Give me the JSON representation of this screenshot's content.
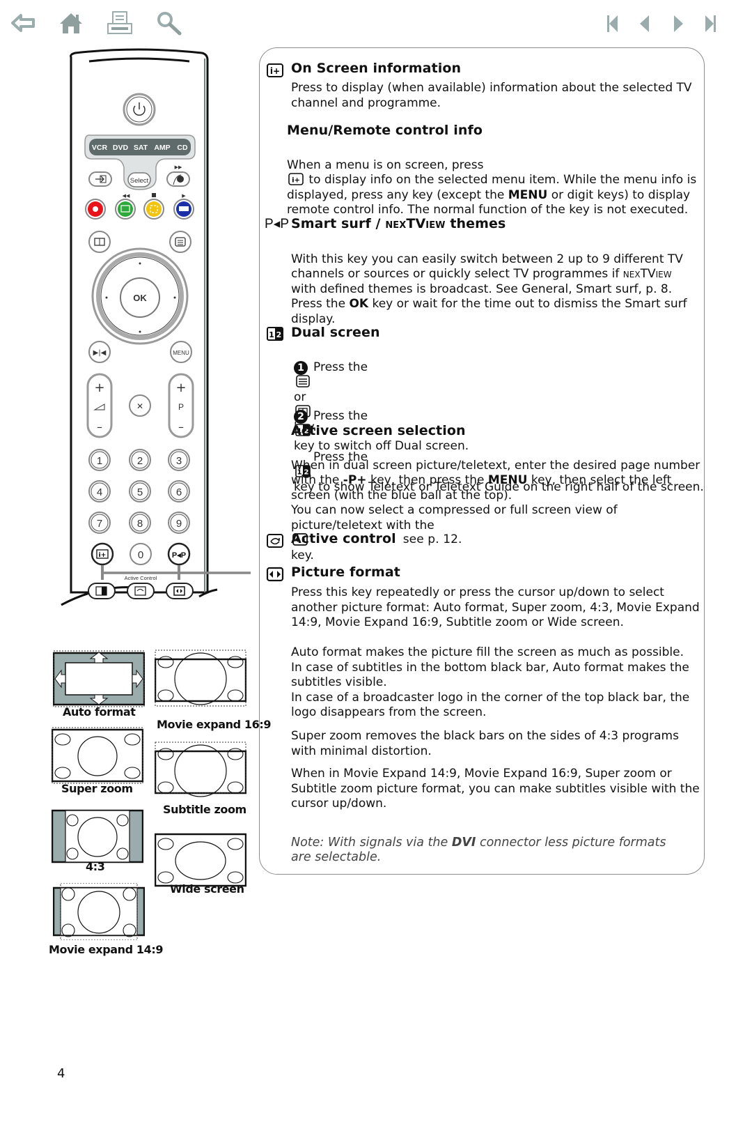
{
  "nav": {
    "left_icons": [
      "back-arrow-icon",
      "home-icon",
      "print-icon",
      "search-icon"
    ],
    "right_icons": [
      "first-page-icon",
      "previous-page-icon",
      "next-page-icon",
      "last-page-icon"
    ],
    "icon_color": "#9aacab"
  },
  "remote": {
    "source_keys": [
      "VCR",
      "DVD",
      "SAT",
      "AMP",
      "CD"
    ],
    "select_label": "Select",
    "ok_label": "OK",
    "menu_label": "MENU",
    "program_label": "P",
    "digits": [
      "1",
      "2",
      "3",
      "4",
      "5",
      "6",
      "7",
      "8",
      "9",
      "0"
    ],
    "smart_surf_label": "P◂P",
    "active_control_label": "Active Control",
    "color_keys": [
      "#e8141a",
      "#2da83a",
      "#f1c40f",
      "#1b2fa8"
    ]
  },
  "sections": {
    "onscreen": {
      "title": "On Screen information",
      "body": "Press to display (when available) information about the selected TV channel and programme."
    },
    "menuinfo": {
      "title": "Menu/Remote control info",
      "body_pre": "When a menu is on screen, press",
      "body_post": " to display info on the selected menu item. While the menu info is displayed, press any key (except the ",
      "body_bold": "MENU",
      "body_end": " or digit keys) to display remote control info. The normal function of the key is not executed."
    },
    "smartsurf": {
      "icon_text": "P◂P",
      "title_a": "Smart surf / ",
      "title_b": "nexTView",
      "title_c": " themes",
      "body_1": "With this key you can easily switch between 2 up to 9 different TV channels or sources or quickly select TV programmes if ",
      "body_sc": "nexTView",
      "body_2": " with defined themes is broadcast. See General, Smart surf, p. 8.",
      "body_3": "Press the ",
      "body_bold": "OK",
      "body_4": " key or wait for the time out to dismiss the Smart surf display."
    },
    "dual": {
      "title": "Dual screen",
      "step1_num": "1",
      "step1_a": "Press the",
      "step1_or": "or",
      "step1_b": "key.",
      "step1_c": "Press the",
      "step1_d": "key to show Teletext or Teletext Guide on the right half of the screen.",
      "step2_num": "2",
      "step2_a": "Press the",
      "step2_b": "key to switch off Dual screen."
    },
    "active_sel": {
      "title": "Active screen selection",
      "b1": "When in dual screen picture/teletext, enter the desired page number with the ",
      "b1_bold": "-P+",
      "b2": " key, then press the ",
      "b2_bold": "MENU",
      "b3": " key, then select the left screen (with the blue ball at the top).",
      "b4": "You can now select a compressed or full screen view of picture/teletext with the",
      "b5": "key."
    },
    "active_ctrl": {
      "title": "Active control",
      "see": "see p. 12."
    },
    "picture": {
      "title": "Picture format",
      "p1": "Press this key repeatedly or press the cursor up/down to select another picture format: Auto format, Super zoom, 4:3, Movie Expand 14:9, Movie Expand 16:9, Subtitle zoom or Wide screen.",
      "p2": "Auto format makes the picture fill the screen as much as possible.\nIn case of subtitles in the bottom black bar, Auto format makes the subtitles visible.\nIn case of a broadcaster logo in the corner of the top black bar, the logo disappears from the screen.",
      "p3": "Super zoom removes the black bars on the sides of 4:3 programs with minimal distortion.",
      "p4": "When in Movie Expand 14:9, Movie Expand 16:9, Super zoom or Subtitle zoom picture format, you can make subtitles visible with the cursor up/down.",
      "note_a": "Note: With signals via the ",
      "note_bold": "DVI",
      "note_b": " connector less picture formats are selectable."
    }
  },
  "formats": [
    {
      "label": "Auto format"
    },
    {
      "label": "Movie expand 16:9"
    },
    {
      "label": "Super zoom"
    },
    {
      "label": "Subtitle zoom"
    },
    {
      "label": "4:3"
    },
    {
      "label": "Wide screen"
    },
    {
      "label": "Movie expand 14:9"
    }
  ],
  "page_number": "4"
}
